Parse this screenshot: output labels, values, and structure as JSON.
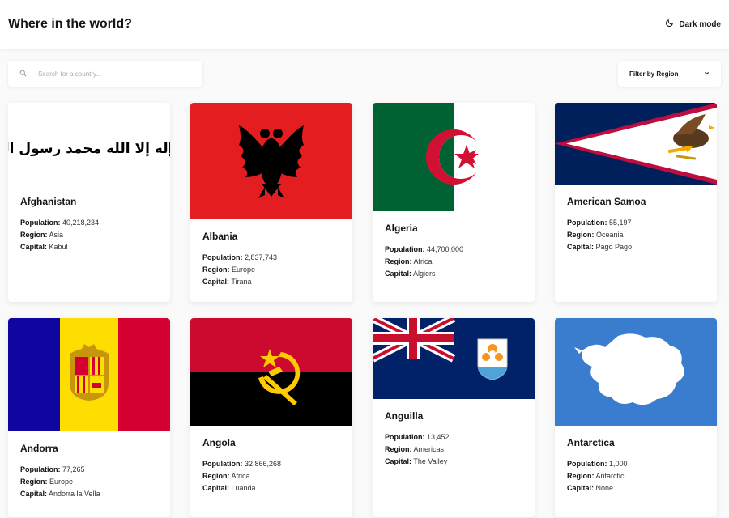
{
  "header": {
    "title": "Where in the world?",
    "dark_mode_label": "Dark mode"
  },
  "search": {
    "placeholder": "Search for a country..."
  },
  "filter": {
    "label": "Filter by Region"
  },
  "labels": {
    "population": "Population:",
    "region": "Region:",
    "capital": "Capital:"
  },
  "countries": [
    {
      "name": "Afghanistan",
      "population": "40,218,234",
      "region": "Asia",
      "capital": "Kabul",
      "flag_text": "لا إله إلا الله محمد رسول الله"
    },
    {
      "name": "Albania",
      "population": "2,837,743",
      "region": "Europe",
      "capital": "Tirana"
    },
    {
      "name": "Algeria",
      "population": "44,700,000",
      "region": "Africa",
      "capital": "Algiers"
    },
    {
      "name": "American Samoa",
      "population": "55,197",
      "region": "Oceania",
      "capital": "Pago Pago"
    },
    {
      "name": "Andorra",
      "population": "77,265",
      "region": "Europe",
      "capital": "Andorra la Vella"
    },
    {
      "name": "Angola",
      "population": "32,866,268",
      "region": "Africa",
      "capital": "Luanda"
    },
    {
      "name": "Anguilla",
      "population": "13,452",
      "region": "Americas",
      "capital": "The Valley"
    },
    {
      "name": "Antarctica",
      "population": "1,000",
      "region": "Antarctic",
      "capital": "None"
    }
  ]
}
